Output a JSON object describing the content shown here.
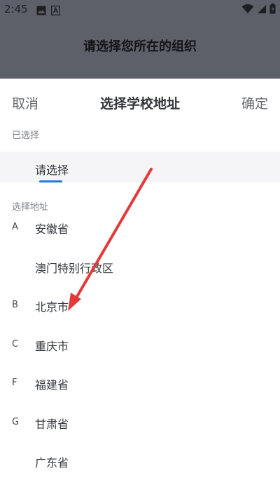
{
  "status_bar": {
    "time": "2:45"
  },
  "background": {
    "title": "请选择您所在的组织"
  },
  "sheet": {
    "cancel_label": "取消",
    "title": "选择学校地址",
    "confirm_label": "确定",
    "selected_section_label": "已选择",
    "selected_tab_label": "请选择",
    "address_section_label": "选择地址",
    "items": [
      {
        "letter": "A",
        "label": "安徽省"
      },
      {
        "letter": "",
        "label": "澳门特别行政区"
      },
      {
        "letter": "B",
        "label": "北京市"
      },
      {
        "letter": "C",
        "label": "重庆市"
      },
      {
        "letter": "F",
        "label": "福建省"
      },
      {
        "letter": "G",
        "label": "甘肃省"
      },
      {
        "letter": "",
        "label": "广东省"
      }
    ]
  },
  "colors": {
    "accent": "#1f7ae6",
    "annotation_arrow": "#e23a3a"
  }
}
